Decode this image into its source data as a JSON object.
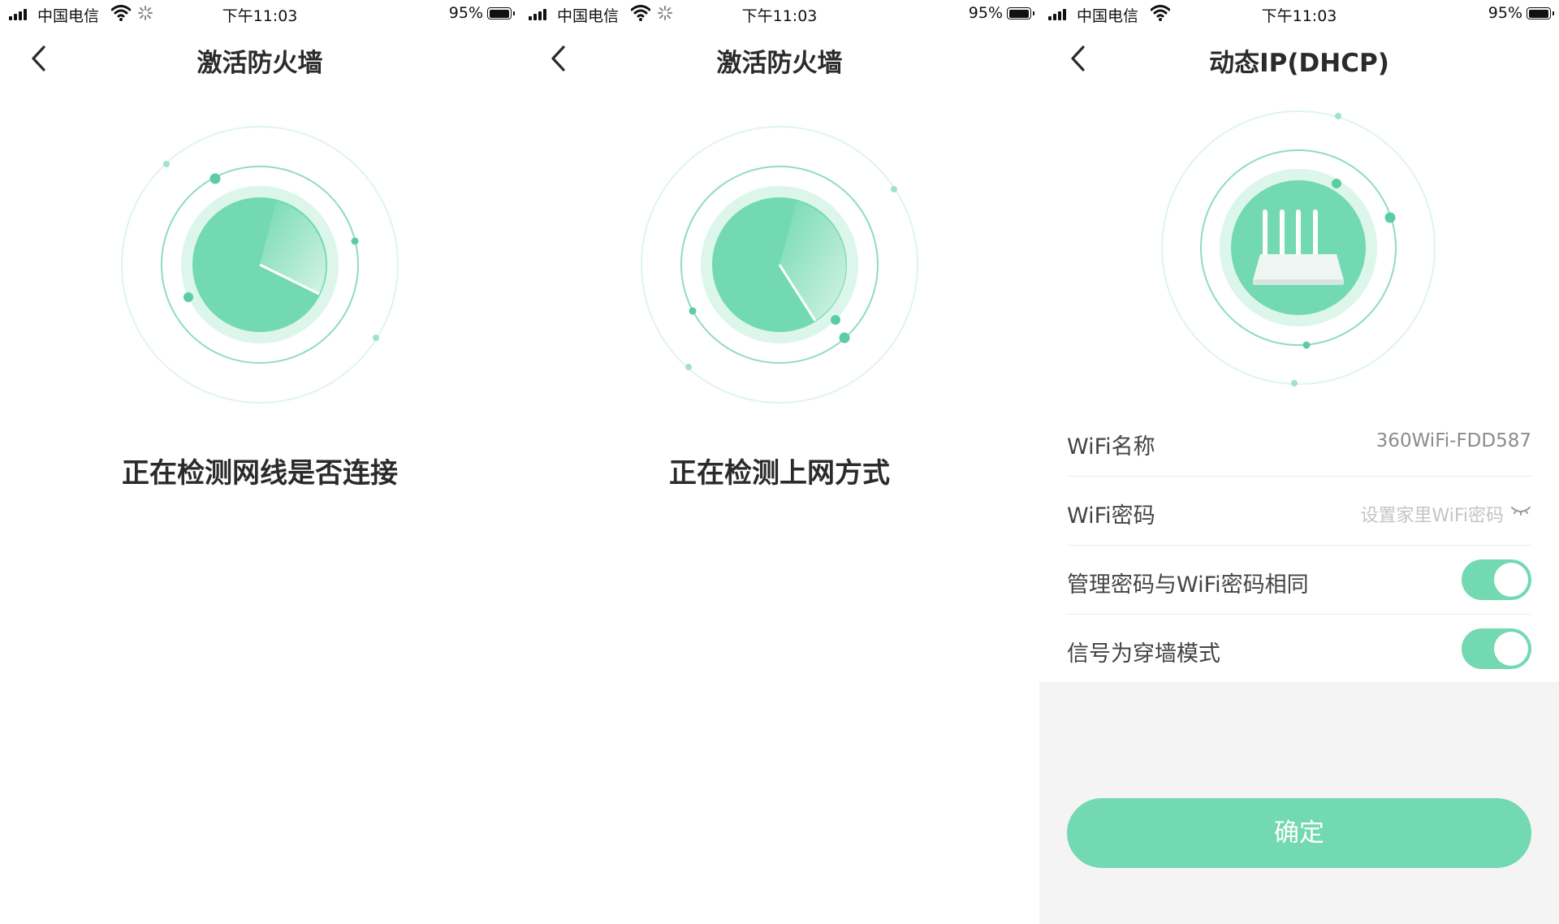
{
  "screens": [
    {
      "status": {
        "carrier": "中国电信",
        "time": "下午11:03",
        "battery_percent": "95%",
        "battery_level": 0.95
      },
      "nav": {
        "title": "激活防火墙"
      },
      "progress_text": "正在检测网线是否连接"
    },
    {
      "status": {
        "carrier": "中国电信",
        "time": "下午11:03",
        "battery_percent": "95%",
        "battery_level": 0.95
      },
      "nav": {
        "title": "激活防火墙"
      },
      "progress_text": "正在检测上网方式"
    },
    {
      "status": {
        "carrier": "中国电信",
        "time": "下午11:03",
        "battery_percent": "95%",
        "battery_level": 0.95
      },
      "nav": {
        "title": "动态IP(DHCP)"
      },
      "form": {
        "wifi_name_label": "WiFi名称",
        "wifi_name_value": "360WiFi-FDD587",
        "wifi_password_label": "WiFi密码",
        "wifi_password_placeholder": "设置家里WiFi密码",
        "same_password_label": "管理密码与WiFi密码相同",
        "same_password_on": true,
        "wall_mode_label": "信号为穿墙模式",
        "wall_mode_on": true
      },
      "confirm_label": "确定"
    }
  ],
  "colors": {
    "accent": "#72d9b2",
    "accent_light": "#dcf6ec",
    "text": "#2b2b2b",
    "muted": "#8c8c8c",
    "footer_bg": "#f4f4f4"
  },
  "icons": [
    "signal-icon",
    "wifi-icon",
    "loading-icon",
    "battery-icon",
    "back-arrow-icon",
    "router-icon",
    "eye-closed-icon"
  ]
}
